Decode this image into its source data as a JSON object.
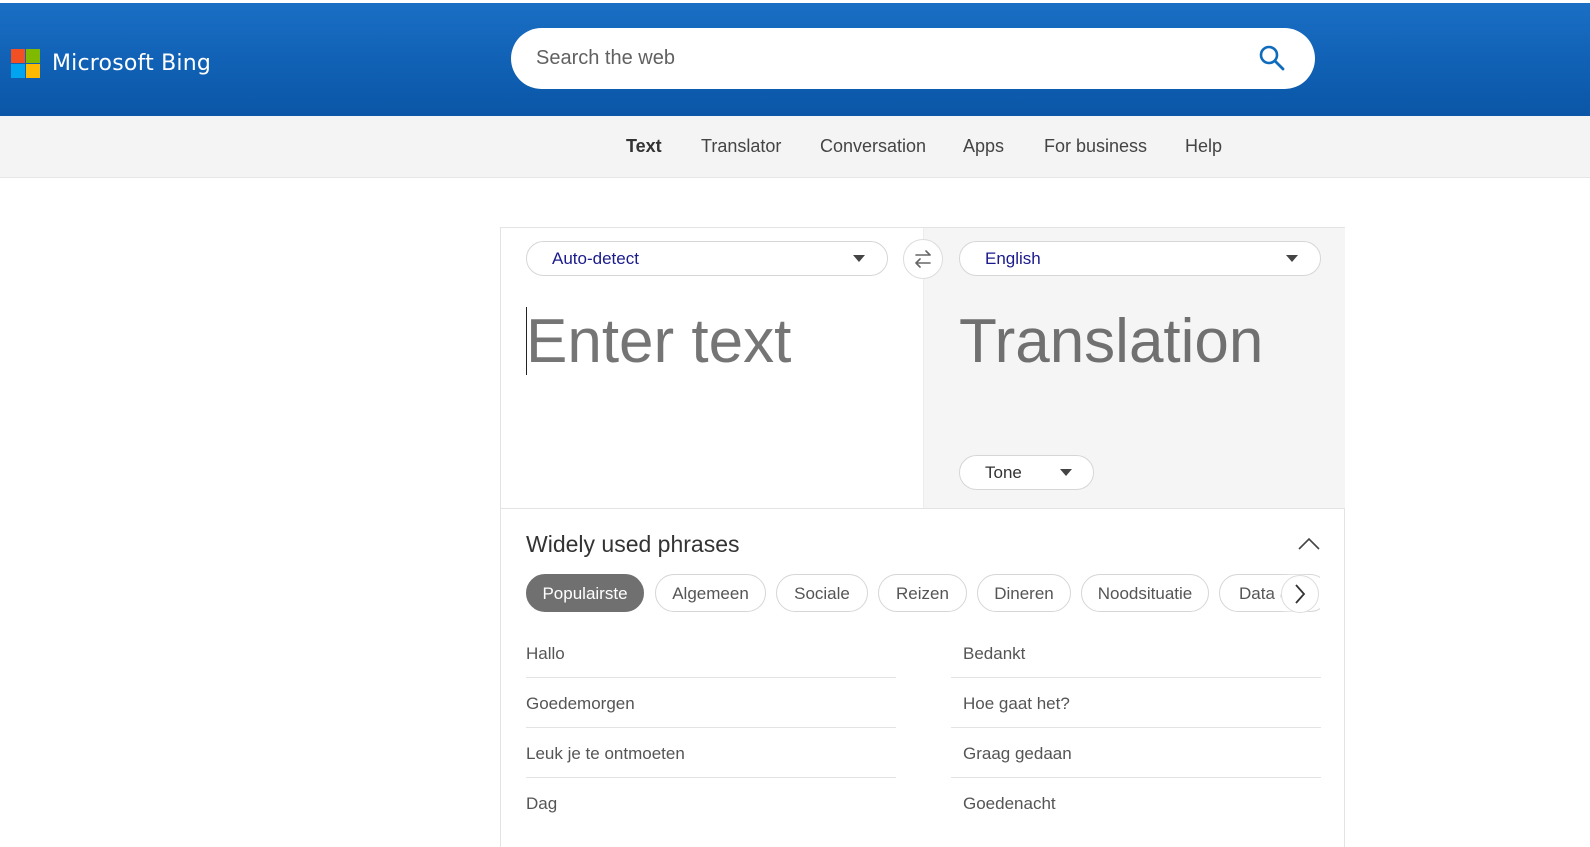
{
  "header": {
    "brand": "Microsoft Bing",
    "logo_colors": [
      "#f25022",
      "#7fba00",
      "#00a4ef",
      "#ffb900"
    ],
    "search_placeholder": "Search the web",
    "search_icon": "search-icon"
  },
  "nav": {
    "items": [
      {
        "label": "Text",
        "active": true
      },
      {
        "label": "Translator",
        "active": false
      },
      {
        "label": "Conversation",
        "active": false
      },
      {
        "label": "Apps",
        "active": false
      },
      {
        "label": "For business",
        "active": false
      },
      {
        "label": "Help",
        "active": false
      }
    ]
  },
  "translator": {
    "source_language": "Auto-detect",
    "target_language": "English",
    "input_placeholder": "Enter text",
    "output_placeholder": "Translation",
    "tone_label": "Tone",
    "swap_icon": "swap-icon"
  },
  "phrases": {
    "title": "Widely used phrases",
    "categories": [
      "Populairste",
      "Algemeen",
      "Sociale",
      "Reizen",
      "Dineren",
      "Noodsituatie",
      "Data &"
    ],
    "selected_category": "Populairste",
    "left_column": [
      "Hallo",
      "Goedemorgen",
      "Leuk je te ontmoeten",
      "Dag"
    ],
    "right_column": [
      "Bedankt",
      "Hoe gaat het?",
      "Graag gedaan",
      "Goedenacht"
    ]
  }
}
